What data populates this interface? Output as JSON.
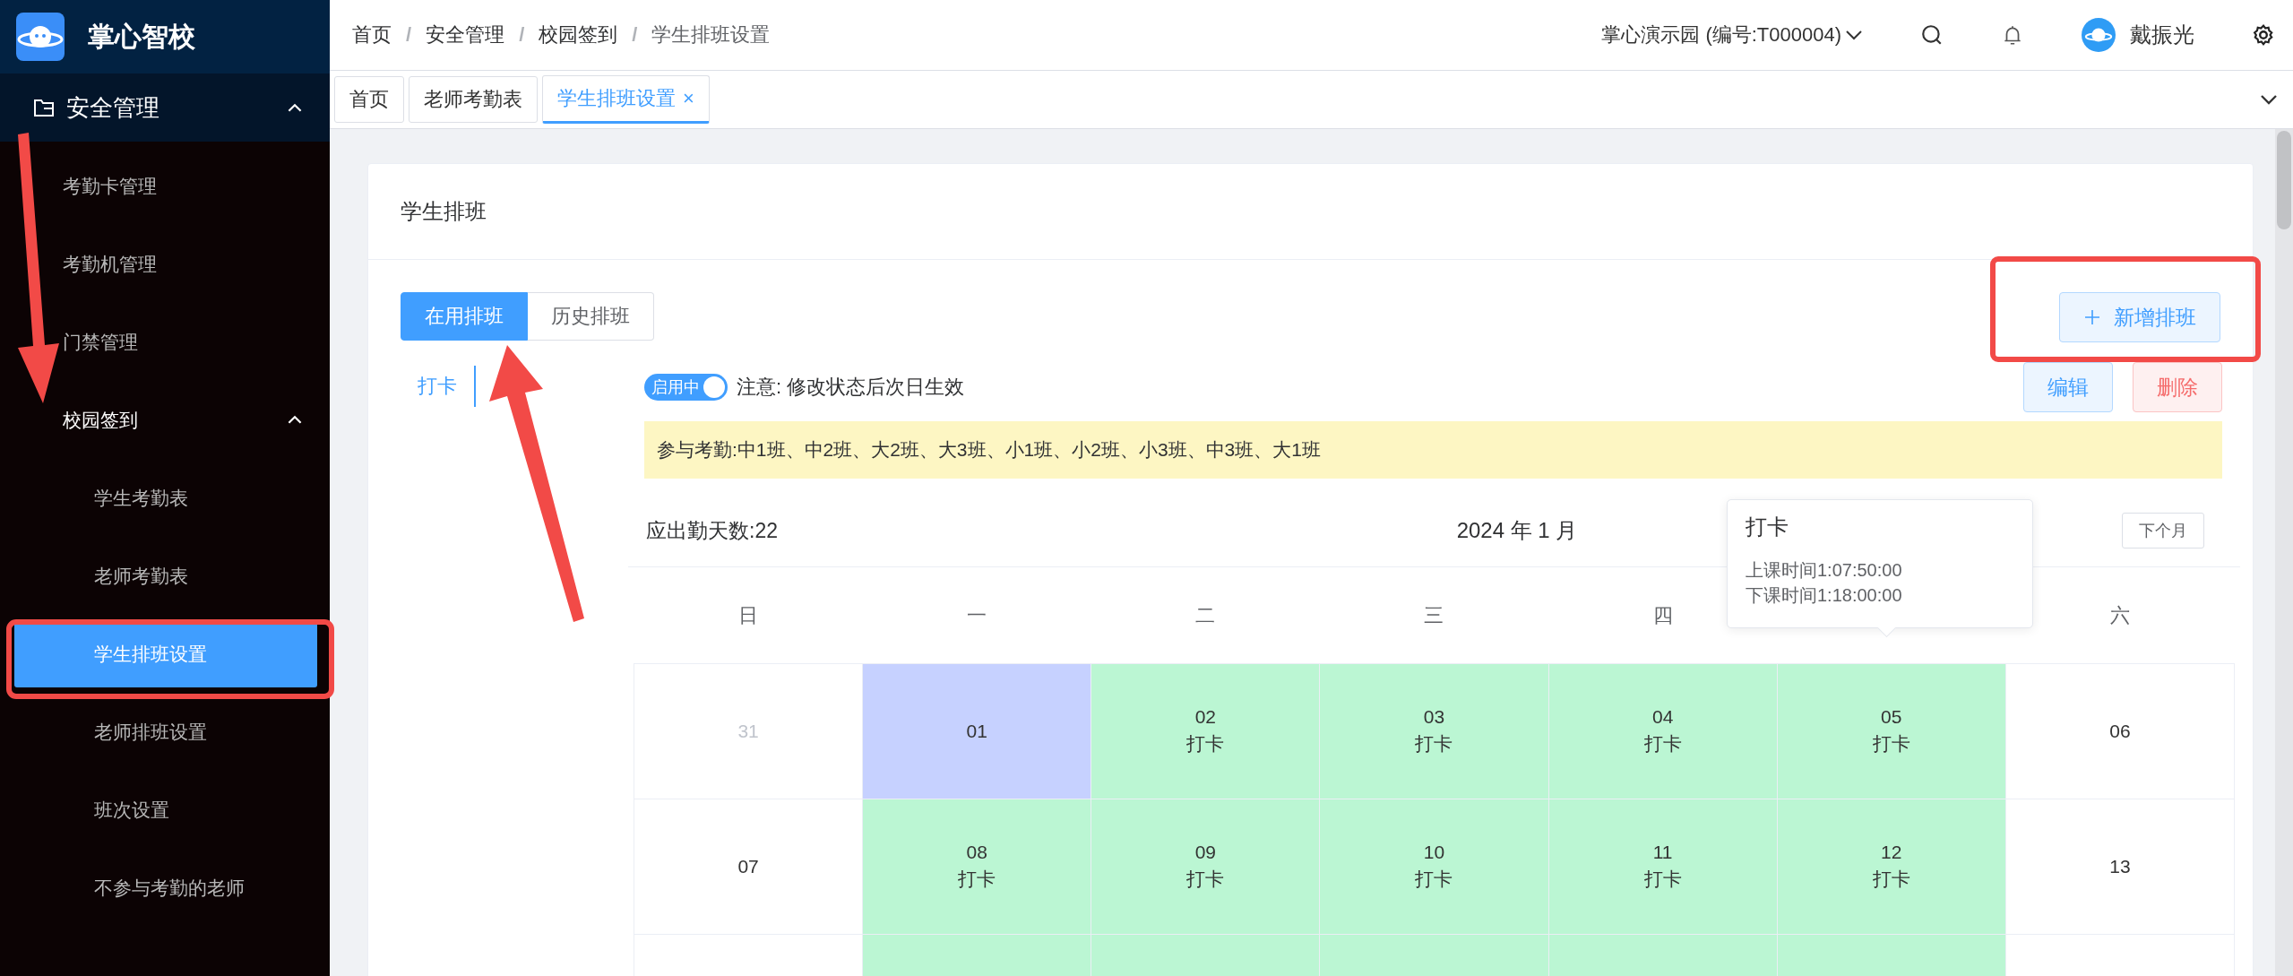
{
  "sidebar": {
    "logo": "掌心智校",
    "section": {
      "label": "安全管理",
      "expanded": true
    },
    "items": [
      {
        "label": "考勤卡管理",
        "selected": false
      },
      {
        "label": "考勤机管理",
        "selected": false
      },
      {
        "label": "门禁管理",
        "selected": false
      },
      {
        "label": "校园签到",
        "selected": false,
        "expanded": true,
        "children": [
          {
            "label": "学生考勤表",
            "selected": false
          },
          {
            "label": "老师考勤表",
            "selected": false
          },
          {
            "label": "学生排班设置",
            "selected": true
          },
          {
            "label": "老师排班设置",
            "selected": false
          },
          {
            "label": "班次设置",
            "selected": false
          },
          {
            "label": "不参与考勤的老师",
            "selected": false
          }
        ]
      }
    ]
  },
  "header": {
    "breadcrumb": [
      {
        "label": "首页"
      },
      {
        "separator": "/",
        "label": "安全管理"
      },
      {
        "separator": "/",
        "label": "校园签到"
      },
      {
        "separator": "/",
        "label": "学生排班设置"
      }
    ],
    "org": "掌心演示园 (编号:T000004)",
    "user": "戴振光"
  },
  "tabs": [
    {
      "label": "首页",
      "selected": false
    },
    {
      "label": "老师考勤表",
      "selected": false
    },
    {
      "label": "学生排班设置",
      "selected": true,
      "close": "×"
    }
  ],
  "card": {
    "title": "学生排班",
    "switch": [
      {
        "label": "在用排班",
        "selected": true
      },
      {
        "label": "历史排班",
        "selected": false
      }
    ],
    "new_button": "新增排班",
    "schedules": [
      {
        "label": "打卡",
        "selected": true
      }
    ],
    "status": {
      "toggle": "启用中",
      "on": true,
      "note": "注意: 修改状态后次日生效"
    },
    "edit": "编辑",
    "delete": "删除",
    "classes": "参与考勤:中1班、中2班、大2班、大3班、小1班、小2班、小3班、中3班、大1班",
    "calendar": {
      "required_days": "应出勤天数:22",
      "month": "2024 年 1 月",
      "next": "下个月",
      "weekdays": [
        {
          "label": "日"
        },
        {
          "label": "一"
        },
        {
          "label": "二"
        },
        {
          "label": "三"
        },
        {
          "label": "四"
        },
        {
          "covered": true
        },
        {
          "label": "六"
        }
      ],
      "rows": [
        [
          {
            "day": "31",
            "kind": "other"
          },
          {
            "day": "01",
            "kind": "today"
          },
          {
            "day": "02",
            "kind": "checkin",
            "label": "打卡"
          },
          {
            "day": "03",
            "kind": "checkin",
            "label": "打卡"
          },
          {
            "day": "04",
            "kind": "checkin",
            "label": "打卡"
          },
          {
            "day": "05",
            "kind": "checkin",
            "label": "打卡"
          },
          {
            "day": "06",
            "kind": "plain"
          }
        ],
        [
          {
            "day": "07",
            "kind": "plain"
          },
          {
            "day": "08",
            "kind": "checkin",
            "label": "打卡"
          },
          {
            "day": "09",
            "kind": "checkin",
            "label": "打卡"
          },
          {
            "day": "10",
            "kind": "checkin",
            "label": "打卡"
          },
          {
            "day": "11",
            "kind": "checkin",
            "label": "打卡"
          },
          {
            "day": "12",
            "kind": "checkin",
            "label": "打卡"
          },
          {
            "day": "13",
            "kind": "plain"
          }
        ],
        [
          {
            "kind": "plain"
          },
          {
            "kind": "checkin"
          },
          {
            "kind": "checkin"
          },
          {
            "kind": "checkin"
          },
          {
            "kind": "checkin"
          },
          {
            "kind": "checkin"
          },
          {
            "kind": "plain"
          }
        ]
      ]
    },
    "tooltip": {
      "title": "打卡",
      "lines": [
        "上课时间1:07:50:00",
        "下课时间1:18:00:00"
      ]
    }
  }
}
